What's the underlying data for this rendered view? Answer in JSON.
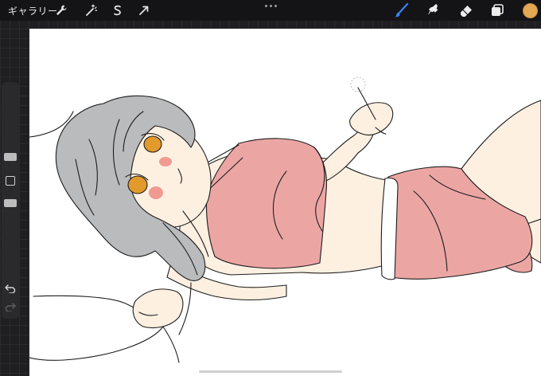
{
  "toolbar": {
    "gallery_label": "ギャラリー",
    "left_tools": [
      "wrench-icon",
      "magic-wand-icon",
      "selection-icon",
      "transform-icon"
    ],
    "more_icon": "more-dots-icon",
    "right_tools": [
      "brush-icon",
      "smudge-icon",
      "eraser-icon",
      "layers-icon"
    ],
    "active_tool": "brush-icon",
    "current_color": "#e3a854",
    "active_tool_color": "#3b82f6"
  },
  "sidebar": {
    "size_slider": "brush-size-slider",
    "modify_button": "modify-square-button",
    "opacity_slider": "brush-opacity-slider",
    "undo_icon": "undo-icon",
    "redo_icon": "redo-icon"
  },
  "canvas": {
    "content": "illustration-artwork",
    "colors": {
      "hair": "#b9bbbd",
      "skin": "#fdf0e1",
      "top": "#eba6a4",
      "shorts": "#eba6a4",
      "eyes": "#e39a2c",
      "blush": "#f09a92",
      "line": "#1d1d1d"
    }
  }
}
